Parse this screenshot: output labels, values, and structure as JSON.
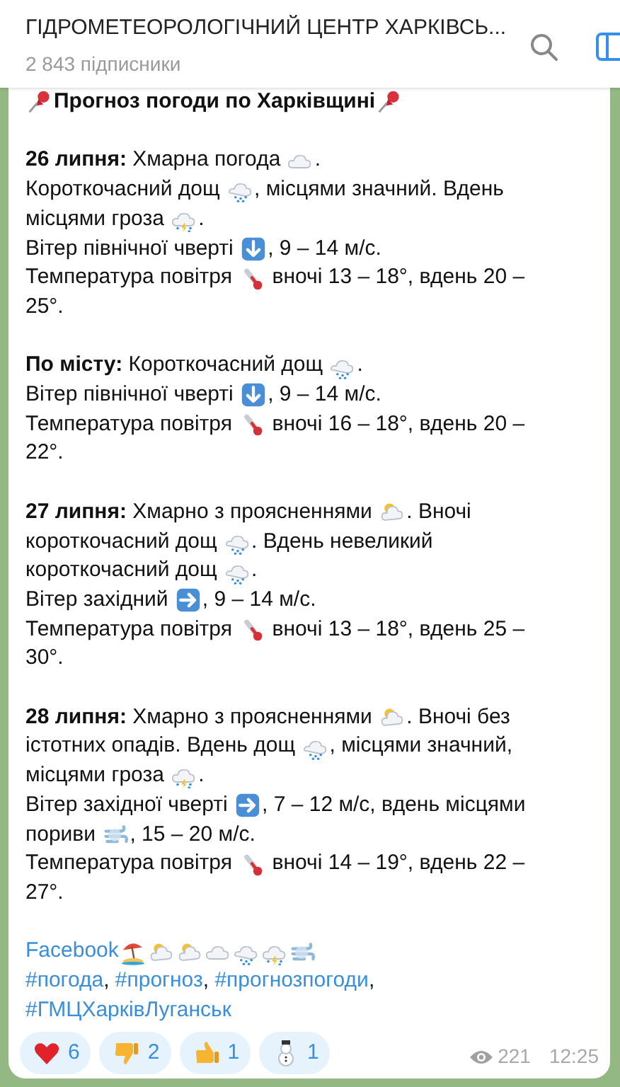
{
  "header": {
    "title": "ГІДРОМЕТЕОРОЛОГІЧНИЙ ЦЕНТР ХАРКІВСЬ...",
    "subtitle": "2 843 підписники"
  },
  "message": {
    "paragraphs": [
      [
        [
          {
            "kind": "pin"
          },
          {
            "kind": "bold",
            "text": "Прогноз погоди по Харківщині"
          },
          {
            "kind": "pin"
          }
        ]
      ],
      [
        [
          {
            "kind": "text",
            "text": "**26 липня:** Хмарна погода "
          },
          {
            "kind": "cloud"
          },
          {
            "kind": "text",
            "text": "."
          }
        ],
        [
          {
            "kind": "text",
            "text": "Короткочасний дощ "
          },
          {
            "kind": "rain"
          },
          {
            "kind": "text",
            "text": ", місцями значний. Вдень"
          }
        ],
        [
          {
            "kind": "text",
            "text": "місцями гроза "
          },
          {
            "kind": "storm"
          },
          {
            "kind": "text",
            "text": "."
          }
        ],
        [
          {
            "kind": "text",
            "text": "Вітер північної чверті "
          },
          {
            "kind": "down"
          },
          {
            "kind": "text",
            "text": ", 9 – 14 м/с."
          }
        ],
        [
          {
            "kind": "text",
            "text": "Температура повітря "
          },
          {
            "kind": "thermo"
          },
          {
            "kind": "text",
            "text": " вночі 13 – 18°, вдень 20 –"
          }
        ],
        [
          {
            "kind": "text",
            "text": "25°."
          }
        ]
      ],
      [
        [
          {
            "kind": "text",
            "text": "**По місту:** Короткочасний дощ "
          },
          {
            "kind": "rain"
          },
          {
            "kind": "text",
            "text": "."
          }
        ],
        [
          {
            "kind": "text",
            "text": "Вітер північної чверті "
          },
          {
            "kind": "down"
          },
          {
            "kind": "text",
            "text": ", 9 – 14 м/с."
          }
        ],
        [
          {
            "kind": "text",
            "text": "Температура повітря "
          },
          {
            "kind": "thermo"
          },
          {
            "kind": "text",
            "text": " вночі 16 – 18°, вдень 20 –"
          }
        ],
        [
          {
            "kind": "text",
            "text": "22°."
          }
        ]
      ],
      [
        [
          {
            "kind": "text",
            "text": "**27 липня:** Хмарно з проясненнями "
          },
          {
            "kind": "suncloud"
          },
          {
            "kind": "text",
            "text": ". Вночі"
          }
        ],
        [
          {
            "kind": "text",
            "text": "короткочасний дощ "
          },
          {
            "kind": "rain"
          },
          {
            "kind": "text",
            "text": ". Вдень невеликий"
          }
        ],
        [
          {
            "kind": "text",
            "text": "короткочасний дощ "
          },
          {
            "kind": "rain"
          },
          {
            "kind": "text",
            "text": "."
          }
        ],
        [
          {
            "kind": "text",
            "text": "Вітер західний "
          },
          {
            "kind": "right"
          },
          {
            "kind": "text",
            "text": ", 9 – 14 м/с."
          }
        ],
        [
          {
            "kind": "text",
            "text": "Температура повітря "
          },
          {
            "kind": "thermo"
          },
          {
            "kind": "text",
            "text": " вночі 13 – 18°, вдень 25 –"
          }
        ],
        [
          {
            "kind": "text",
            "text": "30°."
          }
        ]
      ],
      [
        [
          {
            "kind": "text",
            "text": "**28 липня:** Хмарно з проясненнями "
          },
          {
            "kind": "suncloud"
          },
          {
            "kind": "text",
            "text": ". Вночі без"
          }
        ],
        [
          {
            "kind": "text",
            "text": "істотних опадів. Вдень дощ "
          },
          {
            "kind": "rain"
          },
          {
            "kind": "text",
            "text": ", місцями значний,"
          }
        ],
        [
          {
            "kind": "text",
            "text": "місцями гроза "
          },
          {
            "kind": "storm"
          },
          {
            "kind": "text",
            "text": "."
          }
        ],
        [
          {
            "kind": "text",
            "text": "Вітер західної чверті "
          },
          {
            "kind": "right"
          },
          {
            "kind": "text",
            "text": ", 7 – 12 м/с, вдень місцями"
          }
        ],
        [
          {
            "kind": "text",
            "text": "пориви "
          },
          {
            "kind": "wind"
          },
          {
            "kind": "text",
            "text": ", 15 – 20 м/с."
          }
        ],
        [
          {
            "kind": "text",
            "text": "Температура повітря "
          },
          {
            "kind": "thermo"
          },
          {
            "kind": "text",
            "text": " вночі 14 – 19°, вдень 22 –"
          }
        ],
        [
          {
            "kind": "text",
            "text": "27°."
          }
        ]
      ],
      [
        [
          {
            "kind": "link",
            "text": "Facebook"
          },
          {
            "kind": "beach"
          },
          {
            "kind": "suncloud"
          },
          {
            "kind": "suncloud"
          },
          {
            "kind": "cloud"
          },
          {
            "kind": "rain"
          },
          {
            "kind": "storm"
          },
          {
            "kind": "wind"
          }
        ],
        [
          {
            "kind": "link",
            "text": "#погода"
          },
          {
            "kind": "text",
            "text": ", "
          },
          {
            "kind": "link",
            "text": "#прогноз"
          },
          {
            "kind": "text",
            "text": ", "
          },
          {
            "kind": "link",
            "text": "#прогнозпогоди"
          },
          {
            "kind": "text",
            "text": ","
          }
        ],
        [
          {
            "kind": "link",
            "text": "#ГМЦХарківЛуганськ"
          }
        ]
      ]
    ]
  },
  "reactions": [
    {
      "kind": "heart",
      "count": "6"
    },
    {
      "kind": "thumbsdown",
      "count": "2"
    },
    {
      "kind": "thumbsup",
      "count": "1"
    },
    {
      "kind": "snowman",
      "count": "1"
    }
  ],
  "views": "221",
  "time": "12:25"
}
